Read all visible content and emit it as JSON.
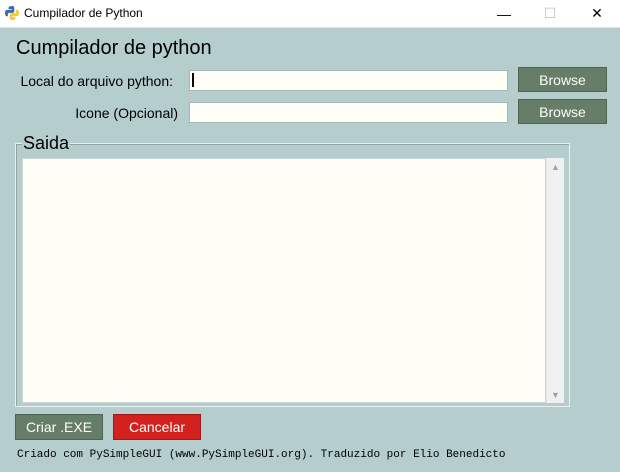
{
  "window": {
    "title": "Cumpilador de Python",
    "min_glyph": "—",
    "max_glyph": "☐",
    "close_glyph": "✕"
  },
  "main": {
    "heading": "Cumpilador de python",
    "file_label": "Local do arquivo python:",
    "file_value": "",
    "icon_label": "Icone (Opcional)",
    "icon_value": "",
    "browse_label": "Browse",
    "output_title": "Saida",
    "output_text": ""
  },
  "actions": {
    "build_label": "Criar .EXE",
    "cancel_label": "Cancelar"
  },
  "footer": {
    "text": "Criado com PySimpleGUI (www.PySimpleGUI.org). Traduzido por Elio Benedicto"
  },
  "colors": {
    "background": "#b5cdcd",
    "button_green": "#667d67",
    "button_red": "#d2211f",
    "field_bg": "#fffff5"
  }
}
